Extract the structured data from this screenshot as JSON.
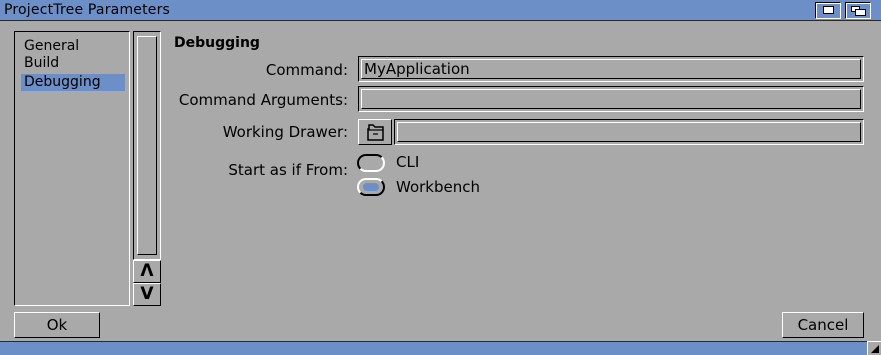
{
  "window": {
    "title": "ProjectTree Parameters"
  },
  "sidebar": {
    "items": [
      {
        "label": "General",
        "selected": false
      },
      {
        "label": "Build",
        "selected": false
      },
      {
        "label": "Debugging",
        "selected": true
      }
    ]
  },
  "scroller": {
    "up_label": "Λ",
    "down_label": "V"
  },
  "section": {
    "heading": "Debugging"
  },
  "fields": {
    "command": {
      "label": "Command:",
      "value": "MyApplication"
    },
    "arguments": {
      "label": "Command Arguments:",
      "value": ""
    },
    "drawer": {
      "label": "Working Drawer:",
      "value": ""
    }
  },
  "start_from": {
    "label": "Start as if From:",
    "options": [
      {
        "label": "CLI",
        "checked": false
      },
      {
        "label": "Workbench",
        "checked": true
      }
    ]
  },
  "buttons": {
    "ok": "Ok",
    "cancel": "Cancel"
  },
  "colors": {
    "titlebar": "#6d8fc8",
    "background": "#a9a9a9",
    "highlight": "#6d8fc8"
  }
}
